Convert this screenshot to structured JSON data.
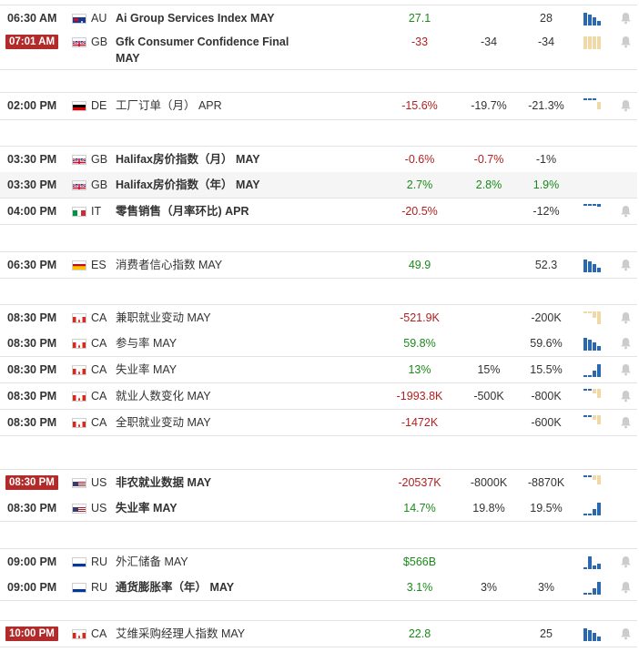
{
  "rows": [
    {
      "time": "06:30 AM",
      "badge": false,
      "cc": "AU",
      "flag": "au-flag-icon",
      "name": "Ai Group Services Index MAY",
      "bold": true,
      "actual": "27.1",
      "act_tone": "pos",
      "forecast": "",
      "prev": "28",
      "chart": "blue",
      "bell": true
    },
    {
      "time": "07:01 AM",
      "badge": true,
      "cc": "GB",
      "flag": "gb-flag-icon",
      "name": "Gfk Consumer Confidence Final MAY",
      "bold": true,
      "actual": "-33",
      "act_tone": "neg",
      "forecast": "-34",
      "prev": "-34",
      "chart": "beige",
      "bell": true
    },
    {
      "time": "02:00 PM",
      "badge": false,
      "cc": "DE",
      "flag": "de-flag-icon",
      "name": "工厂订单（月） APR",
      "bold": false,
      "actual": "-15.6%",
      "act_tone": "neg",
      "forecast": "-19.7%",
      "prev": "-21.3%",
      "chart": "small-mixed",
      "bell": true
    },
    {
      "time": "03:30 PM",
      "badge": false,
      "cc": "GB",
      "flag": "gb-flag-icon",
      "name": "Halifax房价指数（月） MAY",
      "bold": true,
      "actual": "-0.6%",
      "act_tone": "neg",
      "forecast": "-0.7%",
      "prev": "-1%",
      "chart": "none",
      "bell": false
    },
    {
      "time": "03:30 PM",
      "badge": false,
      "cc": "GB",
      "flag": "gb-flag-icon",
      "name": "Halifax房价指数（年） MAY",
      "bold": true,
      "actual": "2.7%",
      "act_tone": "pos",
      "forecast": "2.8%",
      "prev": "1.9%",
      "chart": "none",
      "bell": false
    },
    {
      "time": "04:00 PM",
      "badge": false,
      "cc": "IT",
      "flag": "it-flag-icon",
      "name": "零售销售（月率环比) APR",
      "bold": true,
      "actual": "-20.5%",
      "act_tone": "neg",
      "forecast": "",
      "prev": "-12%",
      "chart": "dashes",
      "bell": true
    },
    {
      "time": "06:30 PM",
      "badge": false,
      "cc": "ES",
      "flag": "es-flag-icon",
      "name": "消费者信心指数 MAY",
      "bold": false,
      "actual": "49.9",
      "act_tone": "pos",
      "forecast": "",
      "prev": "52.3",
      "chart": "blue",
      "bell": true
    },
    {
      "time": "08:30 PM",
      "badge": false,
      "cc": "CA",
      "flag": "ca-flag-icon",
      "name": "兼职就业变动 MAY",
      "bold": false,
      "actual": "-521.9K",
      "act_tone": "neg",
      "forecast": "",
      "prev": "-200K",
      "chart": "beige-small",
      "bell": true
    },
    {
      "time": "08:30 PM",
      "badge": false,
      "cc": "CA",
      "flag": "ca-flag-icon",
      "name": "参与率 MAY",
      "bold": false,
      "actual": "59.8%",
      "act_tone": "pos",
      "forecast": "",
      "prev": "59.6%",
      "chart": "blue",
      "bell": true
    },
    {
      "time": "08:30 PM",
      "badge": false,
      "cc": "CA",
      "flag": "ca-flag-icon",
      "name": "失业率 MAY",
      "bold": false,
      "actual": "13%",
      "act_tone": "pos",
      "forecast": "15%",
      "prev": "15.5%",
      "chart": "rising",
      "bell": true
    },
    {
      "time": "08:30 PM",
      "badge": false,
      "cc": "CA",
      "flag": "ca-flag-icon",
      "name": "就业人数变化 MAY",
      "bold": false,
      "actual": "-1993.8K",
      "act_tone": "neg",
      "forecast": "-500K",
      "prev": "-800K",
      "chart": "dash-beige",
      "bell": true
    },
    {
      "time": "08:30 PM",
      "badge": false,
      "cc": "CA",
      "flag": "ca-flag-icon",
      "name": "全职就业变动 MAY",
      "bold": false,
      "actual": "-1472K",
      "act_tone": "neg",
      "forecast": "",
      "prev": "-600K",
      "chart": "dash-beige",
      "bell": true
    },
    {
      "time": "08:30 PM",
      "badge": true,
      "cc": "US",
      "flag": "us-flag-icon",
      "name": "非农就业数据 MAY",
      "bold": true,
      "actual": "-20537K",
      "act_tone": "neg",
      "forecast": "-8000K",
      "prev": "-8870K",
      "chart": "dash-beige",
      "bell": false
    },
    {
      "time": "08:30 PM",
      "badge": false,
      "cc": "US",
      "flag": "us-flag-icon",
      "name": "失业率 MAY",
      "bold": true,
      "actual": "14.7%",
      "act_tone": "pos",
      "forecast": "19.8%",
      "prev": "19.5%",
      "chart": "rising",
      "bell": false
    },
    {
      "time": "09:00 PM",
      "badge": false,
      "cc": "RU",
      "flag": "ru-flag-icon",
      "name": "外汇储备 MAY",
      "bold": false,
      "actual": "$566B",
      "act_tone": "pos",
      "forecast": "",
      "prev": "",
      "chart": "blue-mid",
      "bell": true
    },
    {
      "time": "09:00 PM",
      "badge": false,
      "cc": "RU",
      "flag": "ru-flag-icon",
      "name": "通货膨胀率（年） MAY",
      "bold": true,
      "actual": "3.1%",
      "act_tone": "pos",
      "forecast": "3%",
      "prev": "3%",
      "chart": "rising",
      "bell": true
    },
    {
      "time": "10:00 PM",
      "badge": true,
      "cc": "CA",
      "flag": "ca-flag-icon",
      "name": "艾维采购经理人指数 MAY",
      "bold": false,
      "actual": "22.8",
      "act_tone": "pos",
      "forecast": "",
      "prev": "25",
      "chart": "blue",
      "bell": true
    }
  ],
  "colors": {
    "positive": "#1a8a1a",
    "negative": "#b22020",
    "badge": "#b22a2a",
    "chart_blue": "#2a68b0",
    "chart_beige": "#f0d9a6",
    "bell": "#cccccc"
  }
}
